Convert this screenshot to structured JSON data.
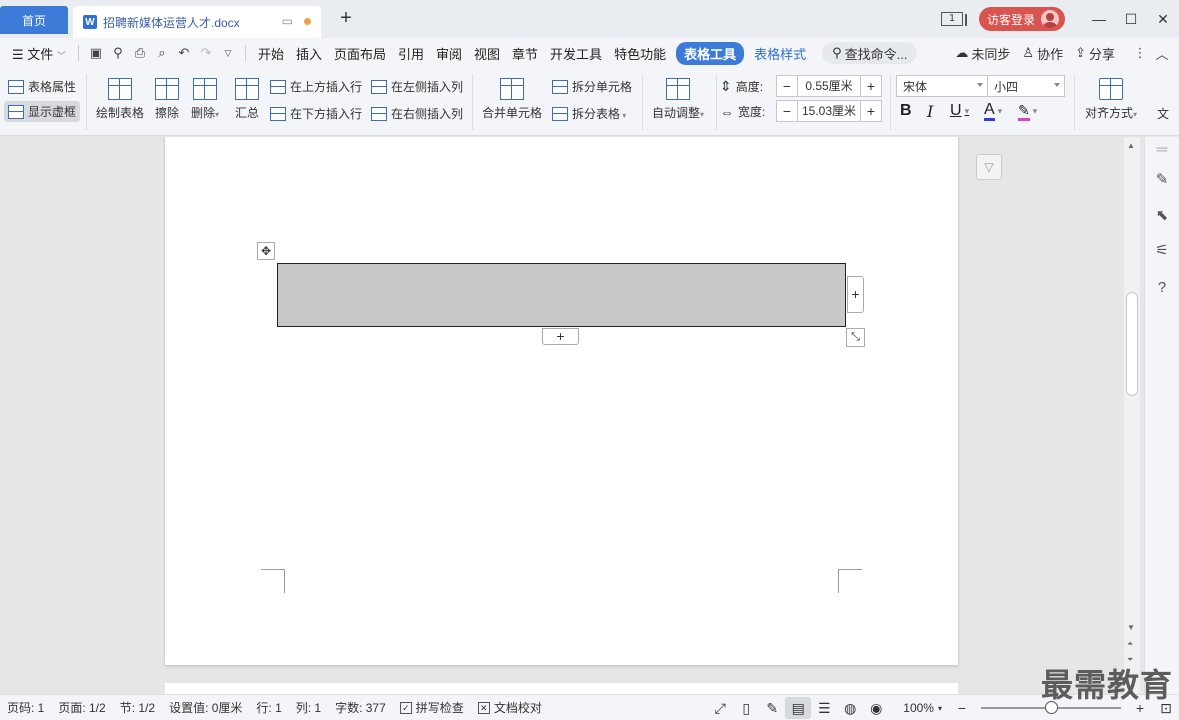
{
  "tabbar": {
    "home": "首页",
    "doc_title": "招聘新媒体运营人才.docx",
    "page_indicator": "1",
    "login": "访客登录"
  },
  "menubar": {
    "file": "文件",
    "tabs": [
      "开始",
      "插入",
      "页面布局",
      "引用",
      "审阅",
      "视图",
      "章节",
      "开发工具",
      "特色功能"
    ],
    "active_tab": "表格工具",
    "style_tab": "表格样式",
    "search": "查找命令...",
    "sync": "未同步",
    "collab": "协作",
    "share": "分享"
  },
  "ribbon": {
    "table_props": "表格属性",
    "show_grid": "显示虚框",
    "draw_table": "绘制表格",
    "erase": "擦除",
    "delete": "删除",
    "summary": "汇总",
    "insert_row_above": "在上方插入行",
    "insert_row_below": "在下方插入行",
    "insert_col_left": "在左侧插入列",
    "insert_col_right": "在右侧插入列",
    "merge_cells": "合并单元格",
    "split_cells": "拆分单元格",
    "split_table": "拆分表格",
    "auto_fit": "自动调整",
    "height_label": "高度:",
    "height_value": "0.55厘米",
    "width_label": "宽度:",
    "width_value": "15.03厘米",
    "font": "宋体",
    "size": "小四",
    "align": "对齐方式",
    "text_dir": "文"
  },
  "status": {
    "page_no": "页码: 1",
    "pages": "页面: 1/2",
    "section": "节: 1/2",
    "setting": "设置值: 0厘米",
    "row": "行: 1",
    "col": "列: 1",
    "words": "字数: 377",
    "spell": "拼写检查",
    "proof": "文档校对",
    "zoom": "100%"
  },
  "watermark": "最需教育",
  "colors": {
    "accent": "#3d7bd9",
    "login": "#d9534f",
    "table_fill": "#c8c8c8",
    "font_color_a": "#2f3fd6",
    "highlight_color": "#e040c0"
  }
}
